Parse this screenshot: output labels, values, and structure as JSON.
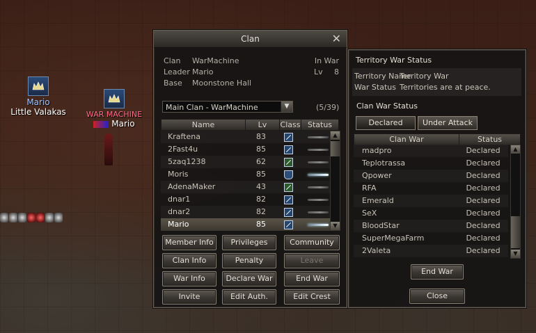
{
  "scene": {
    "player1": {
      "name": "Mario",
      "title": "Little Valakas",
      "name_color": "#9fc3ff"
    },
    "player2": {
      "clan": "WAR MACHINE",
      "name": "Mario",
      "clan_color": "#ff6a8a"
    }
  },
  "clan_window": {
    "title": "Clan",
    "close_icon": "close-icon",
    "info": {
      "clan_label": "Clan",
      "clan_value": "WarMachine",
      "war_status": "In War",
      "leader_label": "Leader",
      "leader_value": "Mario",
      "lv_label": "Lv",
      "lv_value": "8",
      "base_label": "Base",
      "base_value": "Moonstone Hall"
    },
    "selector": {
      "value": "Main Clan - WarMachine",
      "count": "(5/39)"
    },
    "columns": {
      "name": "Name",
      "lv": "Lv",
      "class": "Class",
      "status": "Status"
    },
    "members": [
      {
        "name": "Kraftena",
        "lv": "83",
        "class_icon": "blue",
        "online": false
      },
      {
        "name": "2Fast4u",
        "lv": "85",
        "class_icon": "blue",
        "online": false
      },
      {
        "name": "5zaq1238",
        "lv": "62",
        "class_icon": "green",
        "online": false
      },
      {
        "name": "Moris",
        "lv": "85",
        "class_icon": "shield",
        "online": true
      },
      {
        "name": "AdenaMaker",
        "lv": "43",
        "class_icon": "green",
        "online": false
      },
      {
        "name": "dnar1",
        "lv": "82",
        "class_icon": "blue",
        "online": false
      },
      {
        "name": "dnar2",
        "lv": "82",
        "class_icon": "blue",
        "online": false
      },
      {
        "name": "Mario",
        "lv": "85",
        "class_icon": "blue",
        "online": true,
        "selected": true
      }
    ],
    "buttons": {
      "member_info": "Member Info",
      "privileges": "Privileges",
      "community": "Community",
      "clan_info": "Clan Info",
      "penalty": "Penalty",
      "leave": "Leave",
      "war_info": "War Info",
      "declare_war": "Declare War",
      "end_war": "End War",
      "invite": "Invite",
      "edit_auth": "Edit Auth.",
      "edit_crest": "Edit Crest"
    }
  },
  "territory_window": {
    "title": "Territory War Status",
    "territory_name_label": "Territory Name",
    "territory_name_value": "Territory War",
    "war_status_label": "War Status",
    "war_status_value": "Territories are at peace.",
    "clan_war_status": "Clan War Status",
    "tabs": {
      "declared": "Declared",
      "under_attack": "Under Attack"
    },
    "columns": {
      "clan_war": "Clan War",
      "status": "Status"
    },
    "wars": [
      {
        "clan": "madpro",
        "status": "Declared"
      },
      {
        "clan": "Teplotrassa",
        "status": "Declared"
      },
      {
        "clan": "Qpower",
        "status": "Declared"
      },
      {
        "clan": "RFA",
        "status": "Declared"
      },
      {
        "clan": "Emerald",
        "status": "Declared"
      },
      {
        "clan": "SeX",
        "status": "Declared"
      },
      {
        "clan": "BloodStar",
        "status": "Declared"
      },
      {
        "clan": "SuperMegaFarm",
        "status": "Declared"
      },
      {
        "clan": "2Valeta",
        "status": "Declared"
      }
    ],
    "end_war": "End War",
    "close": "Close"
  }
}
